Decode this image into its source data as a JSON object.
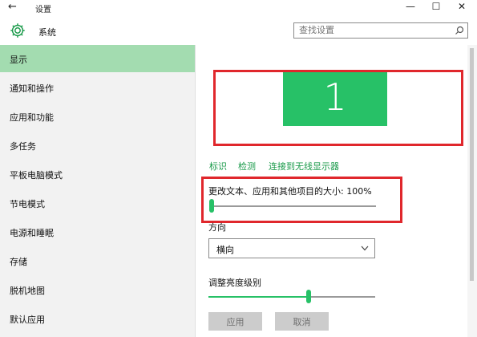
{
  "window": {
    "title": "设置",
    "back_icon": "←",
    "minimize_icon": "—",
    "maximize_icon": "☐",
    "close_icon": "✕"
  },
  "header": {
    "app_name": "系统",
    "search_placeholder": "查找设置"
  },
  "sidebar": {
    "items": [
      {
        "label": "显示",
        "selected": true
      },
      {
        "label": "通知和操作"
      },
      {
        "label": "应用和功能"
      },
      {
        "label": "多任务"
      },
      {
        "label": "平板电脑模式"
      },
      {
        "label": "节电模式"
      },
      {
        "label": "电源和睡眠"
      },
      {
        "label": "存储"
      },
      {
        "label": "脱机地图"
      },
      {
        "label": "默认应用"
      }
    ]
  },
  "display": {
    "monitor_number": "1",
    "links": [
      "标识",
      "检测",
      "连接到无线显示器"
    ],
    "scale_label": "更改文本、应用和其他项目的大小: 100%",
    "scale_value_percent": 100,
    "orientation_label": "方向",
    "orientation_value": "横向",
    "brightness_label": "调整亮度级别",
    "brightness_level_fraction": 0.6,
    "apply_button": "应用",
    "cancel_button": "取消"
  },
  "colors": {
    "accent": "#27c167",
    "sidebar_selected": "#a3dcb0",
    "annotation_red": "#e0272c",
    "link": "#1a9a4a"
  }
}
